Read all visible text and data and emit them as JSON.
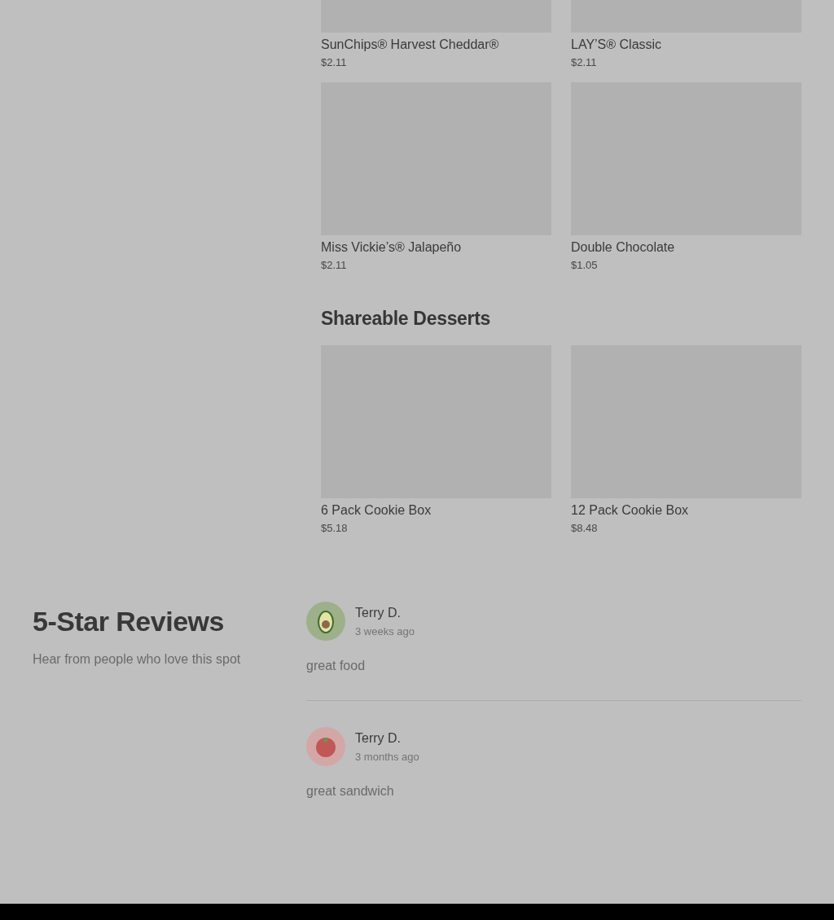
{
  "menu_sections": [
    {
      "items": [
        {
          "name": "SunChips® Harvest Cheddar®",
          "price": "$2.11"
        },
        {
          "name": "LAY’S® Classic",
          "price": "$2.11"
        },
        {
          "name": "Miss Vickie’s® Jalapeño",
          "price": "$2.11"
        },
        {
          "name": "Double Chocolate",
          "price": "$1.05"
        }
      ]
    },
    {
      "title": "Shareable Desserts",
      "items": [
        {
          "name": "6 Pack Cookie Box",
          "price": "$5.18"
        },
        {
          "name": "12 Pack Cookie Box",
          "price": "$8.48"
        }
      ]
    }
  ],
  "reviews": {
    "title": "5-Star Reviews",
    "subtitle": "Hear from people who love this spot",
    "items": [
      {
        "kind": "avocado",
        "author": "Terry D.",
        "time": "3 weeks ago",
        "text": "great food"
      },
      {
        "kind": "tomato",
        "author": "Terry D.",
        "time": "3 months ago",
        "text": "great sandwich"
      }
    ]
  }
}
